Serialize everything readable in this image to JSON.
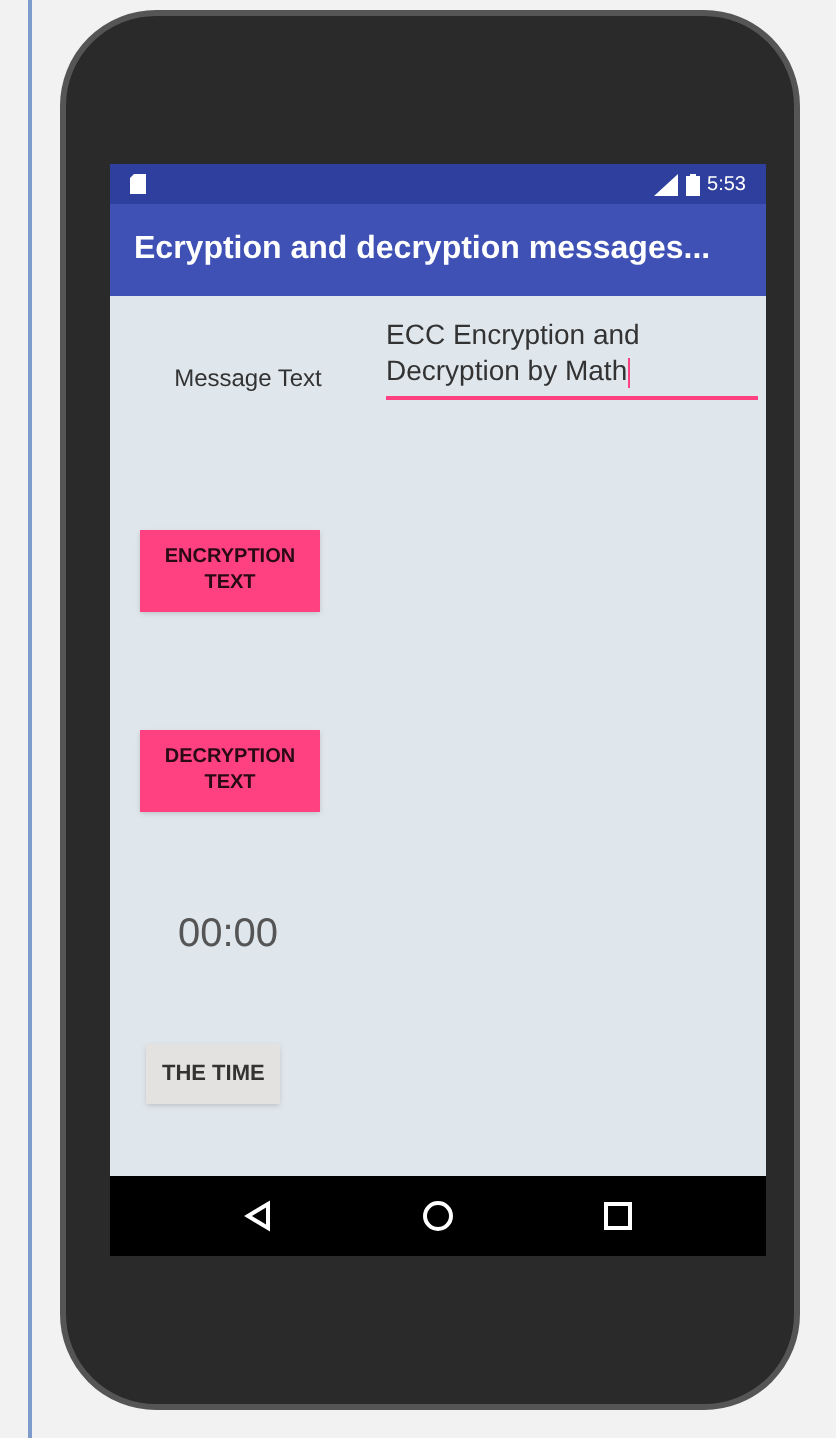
{
  "status_bar": {
    "time": "5:53"
  },
  "app_bar": {
    "title": "Ecryption and decryption messages..."
  },
  "message": {
    "label": "Message Text",
    "value": "ECC Encryption and Decryption by Math",
    "focused": true
  },
  "buttons": [
    {
      "label": "ENCRYPTION TEXT",
      "kind": "accent"
    },
    {
      "label": "DECRYPTION TEXT",
      "kind": "accent"
    }
  ],
  "timer": {
    "text": "00:00"
  },
  "time_button": {
    "label": "THE TIME",
    "kind": "plain"
  }
}
